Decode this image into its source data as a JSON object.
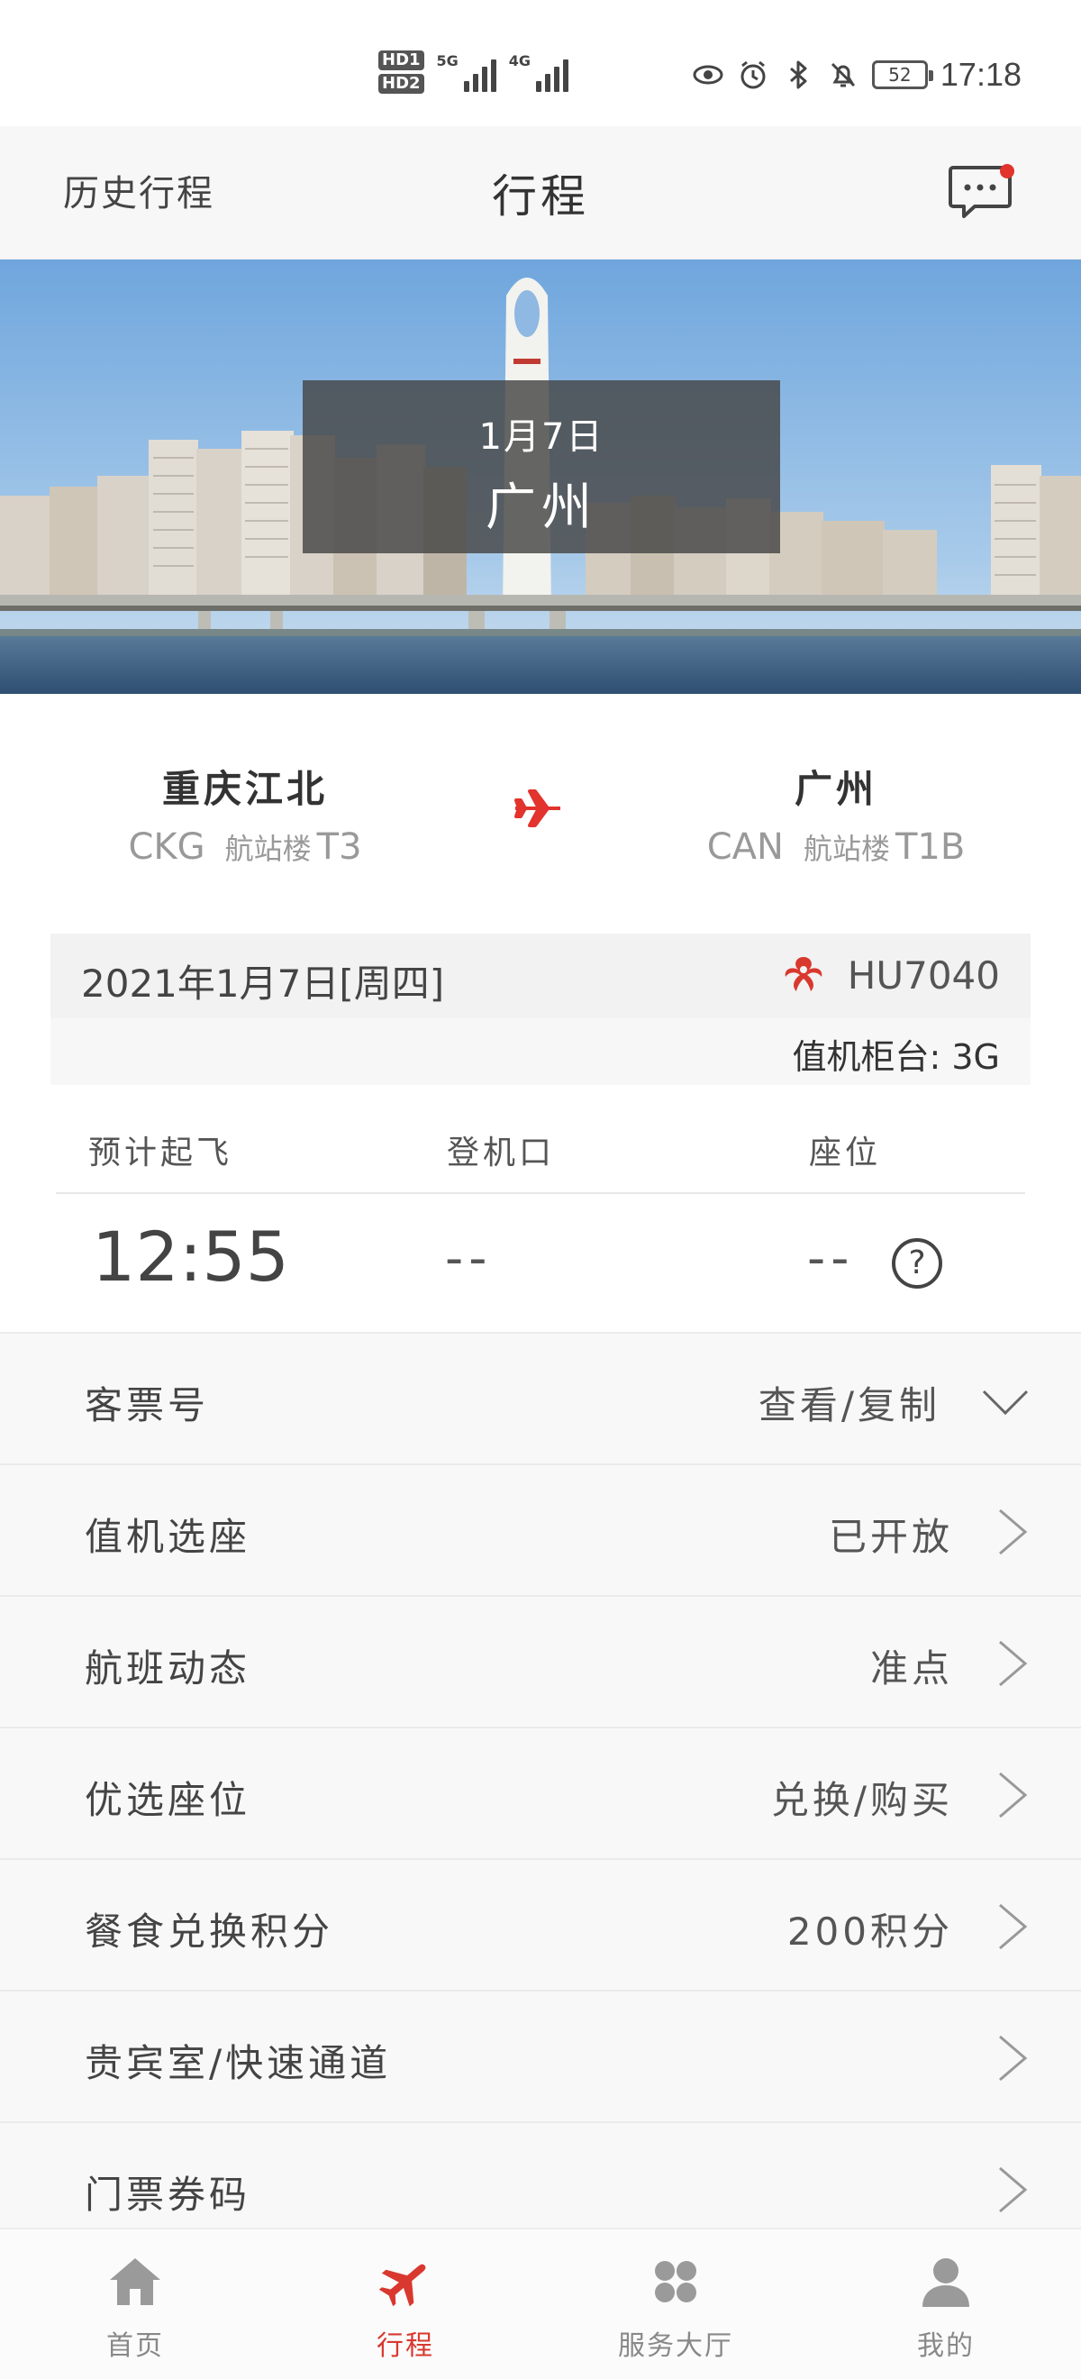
{
  "status_bar": {
    "hd1": "HD1",
    "hd2": "HD2",
    "sig1_label": "5G",
    "sig2_label": "4G",
    "battery": "52",
    "time": "17:18"
  },
  "header": {
    "history_label": "历史行程",
    "title": "行程"
  },
  "banner": {
    "date": "1月7日",
    "city": "广州"
  },
  "route": {
    "origin": {
      "name": "重庆江北",
      "code": "CKG",
      "terminal_label": "航站楼",
      "terminal": "T3"
    },
    "destination": {
      "name": "广州",
      "code": "CAN",
      "terminal_label": "航站楼",
      "terminal": "T1B"
    }
  },
  "flight": {
    "date": "2021年1月7日[周四]",
    "number": "HU7040",
    "checkin_counter": "值机柜台: 3G"
  },
  "times": {
    "departure_label": "预计起飞",
    "gate_label": "登机口",
    "seat_label": "座位",
    "departure_value": "12:55",
    "gate_value": "--",
    "seat_value": "--",
    "help_symbol": "?"
  },
  "menu": [
    {
      "label": "客票号",
      "value": "查看/复制"
    },
    {
      "label": "值机选座",
      "value": "已开放"
    },
    {
      "label": "航班动态",
      "value": "准点"
    },
    {
      "label": "优选座位",
      "value": "兑换/购买"
    },
    {
      "label": "餐食兑换积分",
      "value": "200积分"
    },
    {
      "label": "贵宾室/快速通道",
      "value": ""
    },
    {
      "label": "门票券码",
      "value": ""
    }
  ],
  "tabs": [
    {
      "label": "首页",
      "icon": "home-icon"
    },
    {
      "label": "行程",
      "icon": "plane-icon"
    },
    {
      "label": "服务大厅",
      "icon": "grid-icon"
    },
    {
      "label": "我的",
      "icon": "user-icon"
    }
  ],
  "colors": {
    "accent": "#d9382f",
    "notification_dot": "#e2332d"
  }
}
